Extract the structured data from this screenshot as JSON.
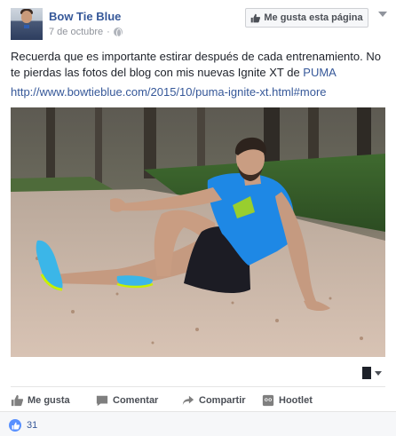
{
  "post": {
    "author": "Bow Tie Blue",
    "date": "7 de octubre",
    "separator": "·",
    "like_page_label": "Me gusta esta página",
    "text_main": "Recuerda que es importante estirar después de cada entrenamiento. No te pierdas las fotos del blog con mis nuevas Ignite XT de ",
    "text_link": "PUMA",
    "url": "http://www.bowtieblue.com/2015/10/puma-ignite-xt.html#more"
  },
  "actions": {
    "like": "Me gusta",
    "comment": "Comentar",
    "share": "Compartir",
    "hootlet": "Hootlet"
  },
  "reactions": {
    "count": "31"
  },
  "colors": {
    "link": "#365899",
    "like_blue": "#5890ff",
    "shirt": "#1e88e5",
    "shoes": "#3bb6e8"
  }
}
